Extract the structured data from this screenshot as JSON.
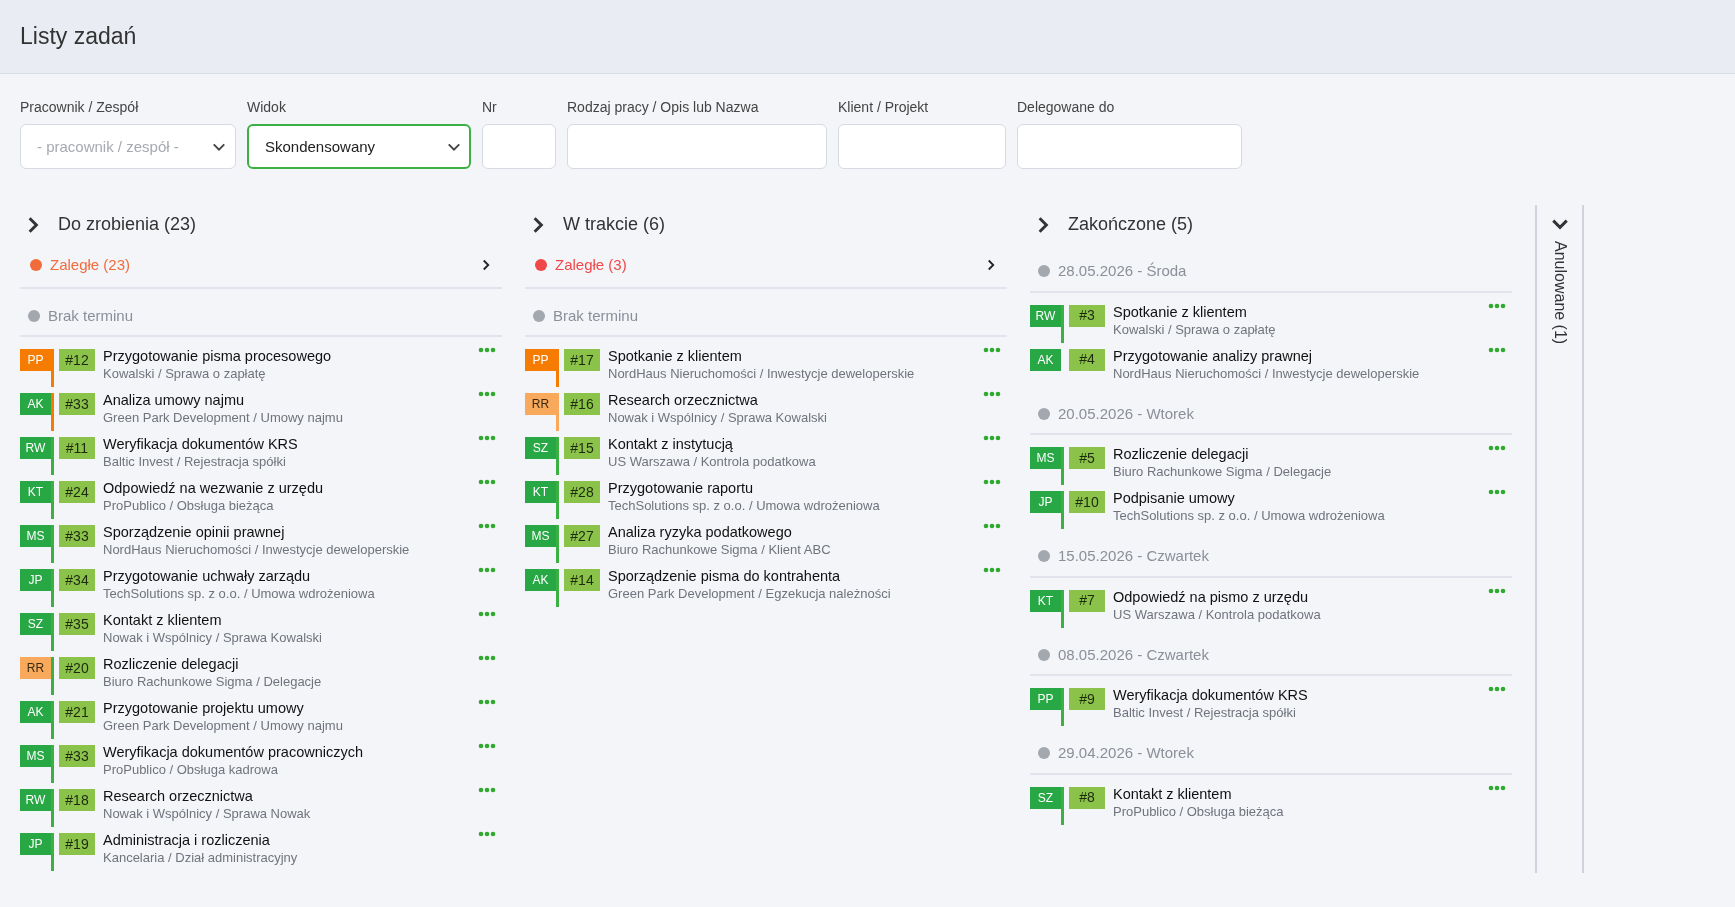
{
  "page_title": "Listy zadań",
  "filters": [
    {
      "label": "Pracownik / Zespół",
      "kind": "select",
      "placeholder": "- pracownik / zespół -",
      "focused": false
    },
    {
      "label": "Widok",
      "kind": "select",
      "value": "Skondensowany",
      "focused": true
    },
    {
      "label": "Nr",
      "kind": "text",
      "focused": false
    },
    {
      "label": "Rodzaj pracy / Opis lub Nazwa",
      "kind": "text",
      "focused": false
    },
    {
      "label": "Klient / Projekt",
      "kind": "text",
      "focused": false
    },
    {
      "label": "Delegowane do",
      "kind": "text",
      "focused": false
    }
  ],
  "columns": [
    {
      "title": "Do zrobienia (23)",
      "expanded": false,
      "groups": [
        {
          "kind": "overdue",
          "label": "Zaległe (23)",
          "color": "#f26b3a"
        },
        {
          "kind": "date",
          "label": "Brak terminu",
          "items": [
            {
              "initials": "PP",
              "color": "#f57c00",
              "track": {
                "color": "#f57c00"
              },
              "number": "#12",
              "title": "Przygotowanie pisma procesowego",
              "subtitle": "Kowalski / Sprawa o zapłatę"
            },
            {
              "initials": "AK",
              "color": "#28a745",
              "track": {
                "color": "#f57c00"
              },
              "number": "#33",
              "title": "Analiza umowy najmu",
              "subtitle": "Green Park Development / Umowy najmu"
            },
            {
              "initials": "RW",
              "color": "#28a745",
              "track": {
                "color": "#3cb043"
              },
              "number": "#11",
              "title": "Weryfikacja dokumentów KRS",
              "subtitle": "Baltic Invest / Rejestracja spółki"
            },
            {
              "initials": "KT",
              "color": "#28a745",
              "track": {
                "color": "#3cb043"
              },
              "number": "#24",
              "title": "Odpowiedź na wezwanie z urzędu",
              "subtitle": "ProPublico / Obsługa bieżąca"
            },
            {
              "initials": "MS",
              "color": "#28a745",
              "track": {
                "color": "#3cb043"
              },
              "number": "#33",
              "title": "Sporządzenie opinii prawnej",
              "subtitle": "NordHaus Nieruchomości / Inwestycje deweloperskie"
            },
            {
              "initials": "JP",
              "color": "#28a745",
              "track": {
                "color": "#3cb043"
              },
              "number": "#34",
              "title": "Przygotowanie uchwały zarządu",
              "subtitle": "TechSolutions sp. z o.o. / Umowa wdrożeniowa"
            },
            {
              "initials": "SZ",
              "color": "#28a745",
              "track": {
                "color": "#3cb043"
              },
              "number": "#35",
              "title": "Kontakt z klientem",
              "subtitle": "Nowak i Wspólnicy / Sprawa Kowalski"
            },
            {
              "initials": "RR",
              "color": "#f9a95b",
              "track": {
                "color": "#3cb043"
              },
              "number": "#20",
              "title": "Rozliczenie delegacji",
              "subtitle": "Biuro Rachunkowe Sigma / Delegacje"
            },
            {
              "initials": "AK",
              "color": "#28a745",
              "track": {
                "color": "#3cb043"
              },
              "number": "#21",
              "title": "Przygotowanie projektu umowy",
              "subtitle": "Green Park Development / Umowy najmu"
            },
            {
              "initials": "MS",
              "color": "#28a745",
              "track": {
                "color": "#3cb043"
              },
              "number": "#33",
              "title": "Weryfikacja dokumentów pracowniczych",
              "subtitle": "ProPublico / Obsługa kadrowa"
            },
            {
              "initials": "RW",
              "color": "#28a745",
              "track": {
                "color": "#3cb043"
              },
              "number": "#18",
              "title": "Research orzecznictwa",
              "subtitle": "Nowak i Wspólnicy / Sprawa Nowak"
            },
            {
              "initials": "JP",
              "color": "#28a745",
              "track": {
                "color": "#3cb043"
              },
              "number": "#19",
              "title": "Administracja i rozliczenia",
              "subtitle": "Kancelaria / Dział administracyjny"
            }
          ]
        }
      ]
    },
    {
      "title": "W trakcie (6)",
      "expanded": false,
      "groups": [
        {
          "kind": "overdue",
          "label": "Zaległe (3)",
          "color": "#f04848"
        },
        {
          "kind": "date",
          "label": "Brak terminu",
          "items": [
            {
              "initials": "PP",
              "color": "#f57c00",
              "track": {
                "color": "#f57c00"
              },
              "number": "#17",
              "title": "Spotkanie z klientem",
              "subtitle": "NordHaus Nieruchomości / Inwestycje deweloperskie"
            },
            {
              "initials": "RR",
              "color": "#f9a95b",
              "track": {
                "color": "#f9a95b"
              },
              "number": "#16",
              "title": "Research orzecznictwa",
              "subtitle": "Nowak i Wspólnicy / Sprawa Kowalski"
            },
            {
              "initials": "SZ",
              "color": "#28a745",
              "track": {
                "color": "#3cb043"
              },
              "number": "#15",
              "title": "Kontakt z instytucją",
              "subtitle": "US Warszawa / Kontrola podatkowa"
            },
            {
              "initials": "KT",
              "color": "#28a745",
              "track": {
                "color": "#3cb043"
              },
              "number": "#28",
              "title": "Przygotowanie raportu",
              "subtitle": "TechSolutions sp. z o.o. / Umowa wdrożeniowa"
            },
            {
              "initials": "MS",
              "color": "#28a745",
              "track": {
                "color": "#3cb043"
              },
              "number": "#27",
              "title": "Analiza ryzyka podatkowego",
              "subtitle": "Biuro Rachunkowe Sigma / Klient ABC"
            },
            {
              "initials": "AK",
              "color": "#28a745",
              "track": {
                "color": "#3cb043"
              },
              "number": "#14",
              "title": "Sporządzenie pisma do kontrahenta",
              "subtitle": "Green Park Development / Egzekucja należności"
            }
          ]
        }
      ]
    },
    {
      "title": "Zakończone (5)",
      "expanded": false,
      "groups": [
        {
          "kind": "date",
          "label": "28.05.2026 - Środa",
          "items": [
            {
              "initials": "RW",
              "color": "#28a745",
              "track": {
                "color": "#3cb043"
              },
              "number": "#3",
              "title": "Spotkanie z klientem",
              "subtitle": "Kowalski / Sprawa o zapłatę"
            },
            {
              "initials": "AK",
              "color": "#28a745",
              "number": "#4",
              "title": "Przygotowanie analizy prawnej",
              "subtitle": "NordHaus Nieruchomości / Inwestycje deweloperskie"
            }
          ]
        },
        {
          "kind": "date",
          "label": "20.05.2026 - Wtorek",
          "items": [
            {
              "initials": "MS",
              "color": "#28a745",
              "track": {
                "color": "#3cb043"
              },
              "number": "#5",
              "title": "Rozliczenie delegacji",
              "subtitle": "Biuro Rachunkowe Sigma / Delegacje"
            },
            {
              "initials": "JP",
              "color": "#28a745",
              "track": {
                "color": "#3cb043"
              },
              "number": "#10",
              "title": "Podpisanie umowy",
              "subtitle": "TechSolutions sp. z o.o. / Umowa wdrożeniowa"
            }
          ]
        },
        {
          "kind": "date",
          "label": "15.05.2026 - Czwartek",
          "items": [
            {
              "initials": "KT",
              "color": "#28a745",
              "track": {
                "color": "#3cb043"
              },
              "number": "#7",
              "title": "Odpowiedź na pismo z urzędu",
              "subtitle": "US Warszawa / Kontrola podatkowa"
            }
          ]
        },
        {
          "kind": "date",
          "label": "08.05.2026 - Czwartek",
          "items": [
            {
              "initials": "PP",
              "color": "#28a745",
              "track": {
                "color": "#3cb043"
              },
              "number": "#9",
              "title": "Weryfikacja dokumentów KRS",
              "subtitle": "Baltic Invest / Rejestracja spółki"
            }
          ]
        },
        {
          "kind": "date",
          "label": "29.04.2026 - Wtorek",
          "items": [
            {
              "initials": "SZ",
              "color": "#28a745",
              "track": {
                "color": "#3cb043"
              },
              "number": "#8",
              "title": "Kontakt z klientem",
              "subtitle": "ProPublico / Obsługa bieżąca"
            }
          ]
        }
      ]
    }
  ],
  "side_panel": {
    "title": "Anulowane (1)",
    "expanded": true
  }
}
